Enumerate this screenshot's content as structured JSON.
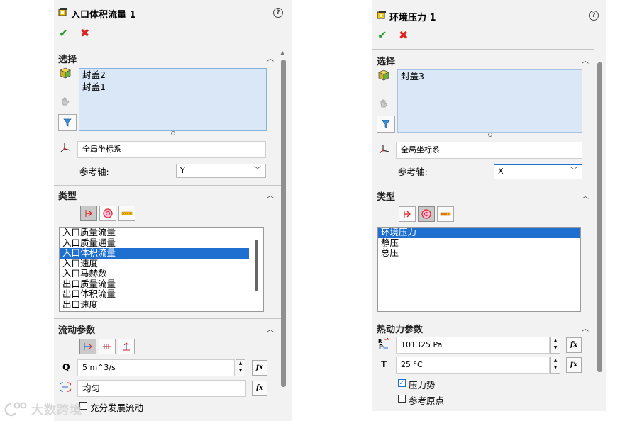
{
  "left": {
    "title": "入口体积流量 1",
    "help": "?",
    "ok_icon": "✔",
    "cancel_icon": "✖",
    "selection": {
      "header": "选择",
      "items": [
        "封盖2",
        "封盖1"
      ],
      "coordinate_system": "全局坐标系",
      "ref_axis_label": "参考轴:",
      "ref_axis_value": "Y"
    },
    "type": {
      "header": "类型",
      "list": [
        "入口质量流量",
        "入口质量通量",
        "入口体积流量",
        "入口速度",
        "入口马赫数",
        "出口质量流量",
        "出口体积流量",
        "出口速度"
      ],
      "selected": "入口体积流量"
    },
    "flow": {
      "header": "流动参数",
      "q_label": "Q",
      "q_value": "5 m^3/s",
      "profile_value": "均匀",
      "fully_developed_label": "充分发展流动",
      "fx": "fx"
    }
  },
  "right": {
    "title": "环境压力 1",
    "help": "?",
    "ok_icon": "✔",
    "cancel_icon": "✖",
    "selection": {
      "header": "选择",
      "items": [
        "封盖3"
      ],
      "coordinate_system": "全局坐标系",
      "ref_axis_label": "参考轴:",
      "ref_axis_value": "X"
    },
    "type": {
      "header": "类型",
      "list": [
        "环境压力",
        "静压",
        "总压"
      ],
      "selected": "环境压力"
    },
    "thermo": {
      "header": "热动力参数",
      "p_value": "101325 Pa",
      "t_label": "T",
      "t_value": "25 °C",
      "pressure_potential_label": "压力势",
      "ref_origin_label": "参考原点",
      "fx": "fx"
    }
  },
  "watermark": "大数跨境",
  "colors": {
    "selection_bg": "#d9e7f6",
    "list_highlight": "#1e6fd0",
    "ok": "#2e9a2e",
    "cancel": "#dd2222"
  }
}
